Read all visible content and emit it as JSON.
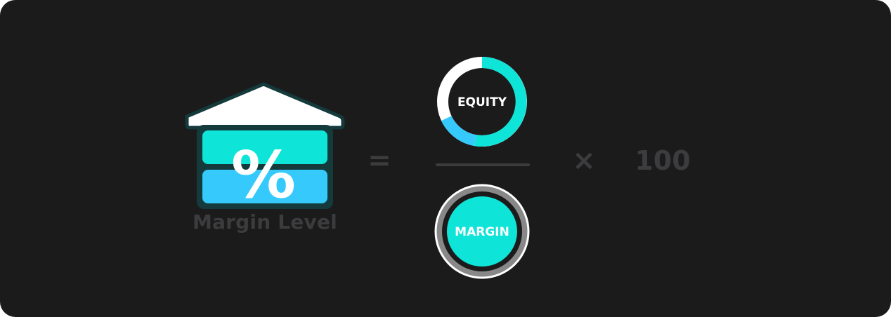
{
  "formula": {
    "result_label": "Margin Level",
    "result_symbol": "%",
    "equals": "=",
    "numerator": "EQUITY",
    "denominator": "MARGIN",
    "times": "×",
    "multiplier": "100"
  },
  "icons": {
    "result": "house-percent-icon",
    "numerator": "donut-ring-icon",
    "denominator": "filled-circle-icon"
  },
  "colors": {
    "background": "#1b1b1b",
    "muted_text": "#3c3c3e",
    "teal": "#0fe4d8",
    "sky_blue": "#36c9fb",
    "white": "#ffffff",
    "gray_ring": "#888888",
    "dark_outline": "#143a3c"
  }
}
